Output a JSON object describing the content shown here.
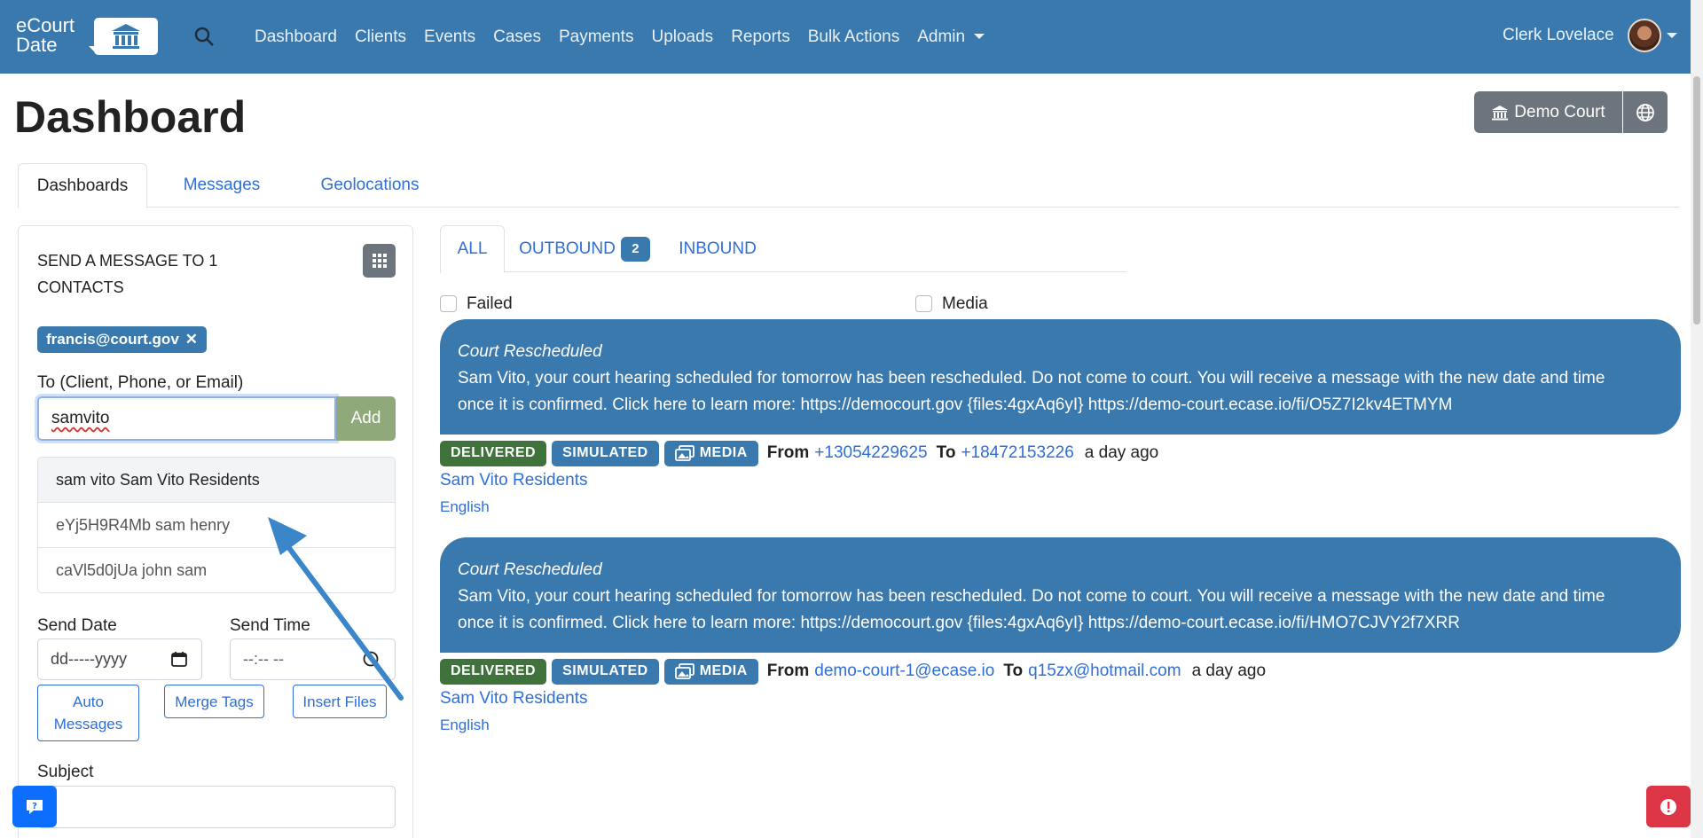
{
  "navbar": {
    "brand_line1": "eCourt",
    "brand_line2": "Date",
    "links": [
      "Dashboard",
      "Clients",
      "Events",
      "Cases",
      "Payments",
      "Uploads",
      "Reports",
      "Bulk Actions",
      "Admin"
    ],
    "user_name": "Clerk Lovelace"
  },
  "header": {
    "title": "Dashboard",
    "court_button": "Demo Court"
  },
  "main_tabs": [
    "Dashboards",
    "Messages",
    "Geolocations"
  ],
  "compose": {
    "title": "SEND A MESSAGE TO 1 CONTACTS",
    "recipient_chip": "francis@court.gov",
    "chip_remove": "✕",
    "to_label": "To (Client, Phone, or Email)",
    "to_value": "samvito",
    "add_label": "Add",
    "suggestions": [
      "sam vito Sam Vito Residents",
      "eYj5H9R4Mb sam henry",
      "caVl5d0jUa john sam"
    ],
    "send_date_label": "Send Date",
    "send_date_placeholder": "dd-----yyyy",
    "send_time_label": "Send Time",
    "send_time_placeholder": "--:-- --",
    "auto_messages_line1": "Auto",
    "auto_messages_line2": "Messages",
    "merge_tags_label": "Merge Tags",
    "insert_files_label": "Insert Files",
    "subject_label": "Subject"
  },
  "message_tabs": {
    "all": "ALL",
    "outbound": "OUTBOUND",
    "outbound_count": "2",
    "inbound": "INBOUND"
  },
  "filters": {
    "failed": "Failed",
    "media": "Media"
  },
  "messages": [
    {
      "subject": "Court Rescheduled",
      "line1": "Sam Vito, your court hearing scheduled for tomorrow has been rescheduled. Do not come to court. You will receive a message with the new date and time",
      "line2": "once it is confirmed. Click here to learn more: https://democourt.gov {files:4gxAq6yI} https://demo-court.ecase.io/fi/O5Z7I2kv4ETMYM",
      "status": "DELIVERED",
      "simulated": "SIMULATED",
      "media": "MEDIA",
      "from_label": "From",
      "from": "+13054229625",
      "to_label": "To",
      "to": "+18472153226",
      "time_ago": "a day ago",
      "contact": "Sam Vito Residents",
      "language": "English"
    },
    {
      "subject": "Court Rescheduled",
      "line1": "Sam Vito, your court hearing scheduled for tomorrow has been rescheduled. Do not come to court. You will receive a message with the new date and time",
      "line2": "once it is confirmed. Click here to learn more: https://democourt.gov {files:4gxAq6yI} https://demo-court.ecase.io/fi/HMO7CJVY2f7XRR",
      "status": "DELIVERED",
      "simulated": "SIMULATED",
      "media": "MEDIA",
      "from_label": "From",
      "from": "demo-court-1@ecase.io",
      "to_label": "To",
      "to": "q15zx@hotmail.com",
      "time_ago": "a day ago",
      "contact": "Sam Vito Residents",
      "language": "English"
    }
  ],
  "colors": {
    "navbar": "#3a79ad",
    "primary_link": "#2f6fd6",
    "delivered": "#40733c",
    "secondary": "#6c757d",
    "danger": "#dc3545",
    "arrow": "#3a86c8"
  }
}
